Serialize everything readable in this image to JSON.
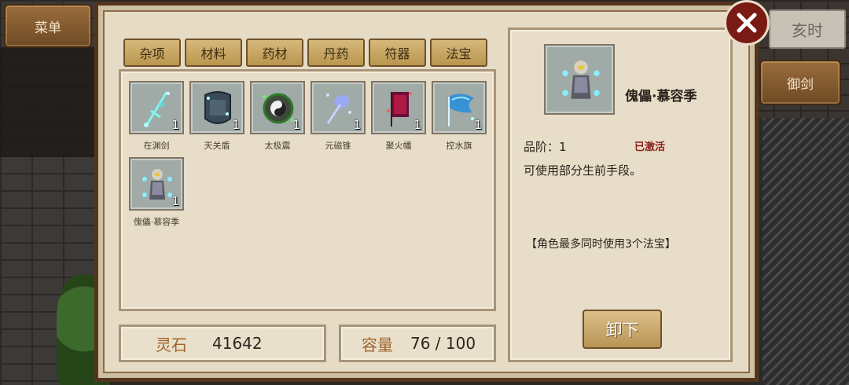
{
  "side": {
    "menu_label": "菜单",
    "time_label": "亥时",
    "sword_label": "御剑"
  },
  "tabs": [
    "杂项",
    "材料",
    "药材",
    "丹药",
    "符器",
    "法宝"
  ],
  "items": [
    {
      "name": "在渊剑",
      "count": "1",
      "icon": "cyan-sword-icon"
    },
    {
      "name": "天关盾",
      "count": "1",
      "icon": "stone-shield-icon"
    },
    {
      "name": "太极震",
      "count": "1",
      "icon": "taiji-disc-icon"
    },
    {
      "name": "元磁锥",
      "count": "1",
      "icon": "magnet-cone-icon"
    },
    {
      "name": "聚火幡",
      "count": "1",
      "icon": "fire-banner-icon"
    },
    {
      "name": "控水旗",
      "count": "1",
      "icon": "water-flag-icon"
    },
    {
      "name": "傀儡·慕容季",
      "count": "1",
      "icon": "puppet-figure-icon"
    }
  ],
  "stats": {
    "stone_label": "灵石",
    "stone_value": "41642",
    "capacity_label": "容量",
    "capacity_value": "76 / 100"
  },
  "detail": {
    "name": "傀儡·慕容季",
    "grade": "品阶：1",
    "status": "已激活",
    "description": "可使用部分生前手段。",
    "note": "【角色最多同时使用3个法宝】",
    "button_label": "卸下"
  },
  "colors": {
    "panel": "#e6dcc6",
    "frame": "#55341c",
    "status_red": "#8b1e17",
    "label_orange": "#a0622a"
  }
}
